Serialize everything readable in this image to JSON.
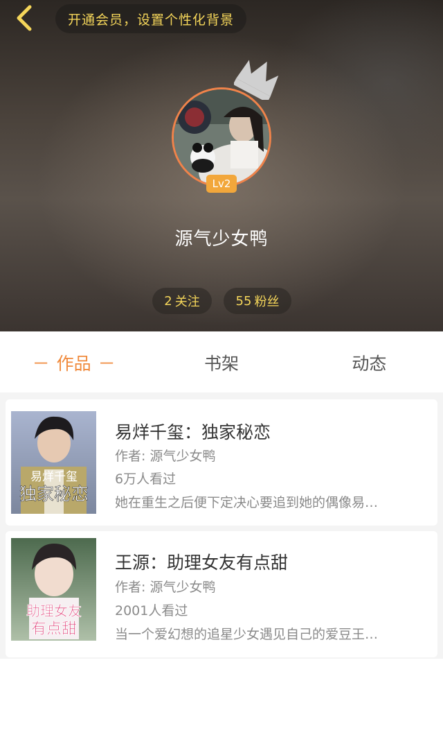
{
  "header": {
    "vip_prompt": "开通会员，设置个性化背景",
    "level": "Lv2",
    "username": "源气少女鸭",
    "following": {
      "count": "2",
      "label": "关注"
    },
    "fans": {
      "count": "55",
      "label": "粉丝"
    }
  },
  "tabs": [
    {
      "label": "作品",
      "active": true
    },
    {
      "label": "书架",
      "active": false
    },
    {
      "label": "动态",
      "active": false
    }
  ],
  "tab_dash": "－",
  "books": [
    {
      "title": "易烊千玺：独家秘恋",
      "author": "作者: 源气少女鸭",
      "views": "6万人看过",
      "description": "她在重生之后便下定决心要追到她的偶像易…",
      "cover_text_top": "易烊千玺",
      "cover_text_main": "独家秘恋"
    },
    {
      "title": "王源：助理女友有点甜",
      "author": "作者: 源气少女鸭",
      "views": "2001人看过",
      "description": "当一个爱幻想的追星少女遇见自己的爱豆王…",
      "cover_text_top": "助理女友",
      "cover_text_main": "有点甜"
    }
  ],
  "colors": {
    "accent": "#f08a3c",
    "gold_text": "#f5d65a",
    "level_badge": "#f2a73b"
  },
  "icons": {
    "back": "chevron-left-icon",
    "crown": "crown-icon"
  }
}
